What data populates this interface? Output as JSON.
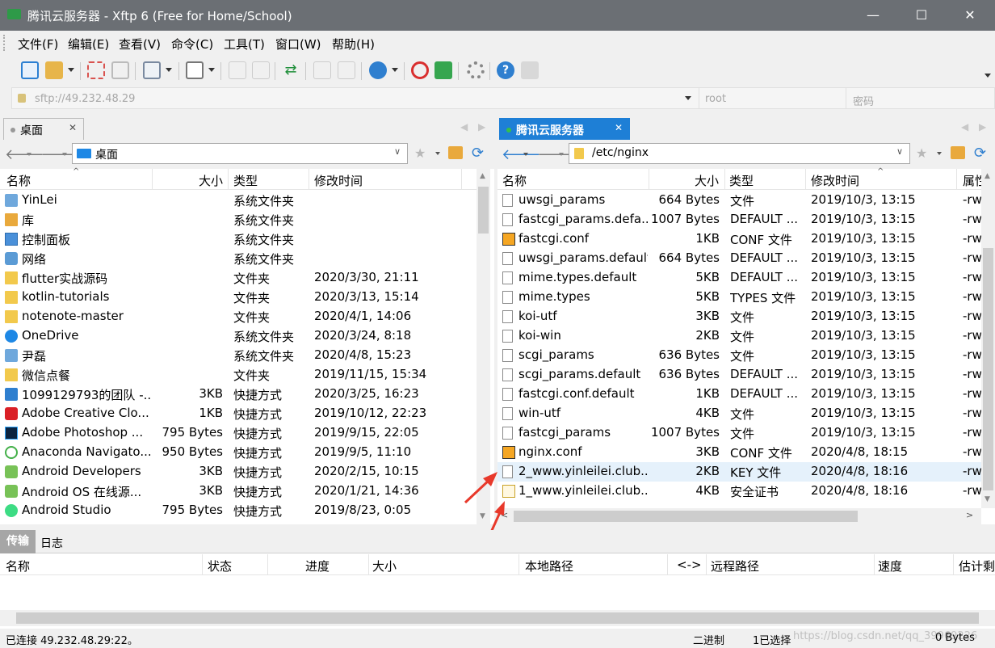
{
  "window": {
    "title": "腾讯云服务器 - Xftp 6 (Free for Home/School)",
    "minimize_glyph": "—",
    "maximize_glyph": "☐",
    "close_glyph": "✕"
  },
  "menu": [
    "文件(F)",
    "编辑(E)",
    "查看(V)",
    "命令(C)",
    "工具(T)",
    "窗口(W)",
    "帮助(H)"
  ],
  "address": {
    "host": "sftp://49.232.48.29",
    "user": "root",
    "password_placeholder": "密码"
  },
  "left": {
    "tab_label": "桌面",
    "path": "桌面",
    "columns": [
      "名称",
      "大小",
      "类型",
      "修改时间"
    ],
    "rows": [
      {
        "name": "YinLei",
        "size": "",
        "type": "系统文件夹",
        "date": "",
        "icon": "user-folder-icon"
      },
      {
        "name": "库",
        "size": "",
        "type": "系统文件夹",
        "date": "",
        "icon": "library-icon"
      },
      {
        "name": "控制面板",
        "size": "",
        "type": "系统文件夹",
        "date": "",
        "icon": "control-panel-icon"
      },
      {
        "name": "网络",
        "size": "",
        "type": "系统文件夹",
        "date": "",
        "icon": "network-icon"
      },
      {
        "name": "flutter实战源码",
        "size": "",
        "type": "文件夹",
        "date": "2020/3/30, 21:11",
        "icon": "folder-icon"
      },
      {
        "name": "kotlin-tutorials",
        "size": "",
        "type": "文件夹",
        "date": "2020/3/13, 15:14",
        "icon": "folder-icon"
      },
      {
        "name": "notenote-master",
        "size": "",
        "type": "文件夹",
        "date": "2020/4/1, 14:06",
        "icon": "folder-icon"
      },
      {
        "name": "OneDrive",
        "size": "",
        "type": "系统文件夹",
        "date": "2020/3/24, 8:18",
        "icon": "onedrive-icon"
      },
      {
        "name": "尹磊",
        "size": "",
        "type": "系统文件夹",
        "date": "2020/4/8, 15:23",
        "icon": "user-folder-icon"
      },
      {
        "name": "微信点餐",
        "size": "",
        "type": "文件夹",
        "date": "2019/11/15, 15:34",
        "icon": "folder-icon"
      },
      {
        "name": "1099129793的团队 -...",
        "size": "3KB",
        "type": "快捷方式",
        "date": "2020/3/25, 16:23",
        "icon": "shortcut-icon"
      },
      {
        "name": "Adobe Creative Clo...",
        "size": "1KB",
        "type": "快捷方式",
        "date": "2019/10/12, 22:23",
        "icon": "adobe-cc-icon"
      },
      {
        "name": "Adobe Photoshop ...",
        "size": "795 Bytes",
        "type": "快捷方式",
        "date": "2019/9/15, 22:05",
        "icon": "photoshop-icon"
      },
      {
        "name": "Anaconda Navigato...",
        "size": "950 Bytes",
        "type": "快捷方式",
        "date": "2019/9/5, 11:10",
        "icon": "anaconda-icon"
      },
      {
        "name": "Android Developers",
        "size": "3KB",
        "type": "快捷方式",
        "date": "2020/2/15, 10:15",
        "icon": "android-icon"
      },
      {
        "name": "Android OS 在线源...",
        "size": "3KB",
        "type": "快捷方式",
        "date": "2020/1/21, 14:36",
        "icon": "android-icon"
      },
      {
        "name": "Android Studio",
        "size": "795 Bytes",
        "type": "快捷方式",
        "date": "2019/8/23, 0:05",
        "icon": "android-studio-icon"
      }
    ]
  },
  "right": {
    "tab_label": "腾讯云服务器",
    "path": "/etc/nginx",
    "columns": [
      "名称",
      "大小",
      "类型",
      "修改时间",
      "属性"
    ],
    "rows": [
      {
        "name": "uwsgi_params",
        "size": "664 Bytes",
        "type": "文件",
        "date": "2019/10/3, 13:15",
        "attr": "-rw",
        "icon": "file-icon"
      },
      {
        "name": "fastcgi_params.defa...",
        "size": "1007 Bytes",
        "type": "DEFAULT ...",
        "date": "2019/10/3, 13:15",
        "attr": "-rw",
        "icon": "file-icon"
      },
      {
        "name": "fastcgi.conf",
        "size": "1KB",
        "type": "CONF 文件",
        "date": "2019/10/3, 13:15",
        "attr": "-rw",
        "icon": "sublime-file-icon"
      },
      {
        "name": "uwsgi_params.default",
        "size": "664 Bytes",
        "type": "DEFAULT ...",
        "date": "2019/10/3, 13:15",
        "attr": "-rw",
        "icon": "file-icon"
      },
      {
        "name": "mime.types.default",
        "size": "5KB",
        "type": "DEFAULT ...",
        "date": "2019/10/3, 13:15",
        "attr": "-rw",
        "icon": "file-icon"
      },
      {
        "name": "mime.types",
        "size": "5KB",
        "type": "TYPES 文件",
        "date": "2019/10/3, 13:15",
        "attr": "-rw",
        "icon": "file-icon"
      },
      {
        "name": "koi-utf",
        "size": "3KB",
        "type": "文件",
        "date": "2019/10/3, 13:15",
        "attr": "-rw",
        "icon": "file-icon"
      },
      {
        "name": "koi-win",
        "size": "2KB",
        "type": "文件",
        "date": "2019/10/3, 13:15",
        "attr": "-rw",
        "icon": "file-icon"
      },
      {
        "name": "scgi_params",
        "size": "636 Bytes",
        "type": "文件",
        "date": "2019/10/3, 13:15",
        "attr": "-rw",
        "icon": "file-icon"
      },
      {
        "name": "scgi_params.default",
        "size": "636 Bytes",
        "type": "DEFAULT ...",
        "date": "2019/10/3, 13:15",
        "attr": "-rw",
        "icon": "file-icon"
      },
      {
        "name": "fastcgi.conf.default",
        "size": "1KB",
        "type": "DEFAULT ...",
        "date": "2019/10/3, 13:15",
        "attr": "-rw",
        "icon": "file-icon"
      },
      {
        "name": "win-utf",
        "size": "4KB",
        "type": "文件",
        "date": "2019/10/3, 13:15",
        "attr": "-rw",
        "icon": "file-icon"
      },
      {
        "name": "fastcgi_params",
        "size": "1007 Bytes",
        "type": "文件",
        "date": "2019/10/3, 13:15",
        "attr": "-rw",
        "icon": "file-icon"
      },
      {
        "name": "nginx.conf",
        "size": "3KB",
        "type": "CONF 文件",
        "date": "2020/4/8, 18:15",
        "attr": "-rw",
        "icon": "sublime-file-icon"
      },
      {
        "name": "2_www.yinleilei.club...",
        "size": "2KB",
        "type": "KEY 文件",
        "date": "2020/4/8, 18:16",
        "attr": "-rw",
        "icon": "file-icon",
        "selected": true
      },
      {
        "name": "1_www.yinleilei.club...",
        "size": "4KB",
        "type": "安全证书",
        "date": "2020/4/8, 18:16",
        "attr": "-rw",
        "icon": "certificate-icon"
      }
    ]
  },
  "transfer": {
    "tabs": [
      "传输",
      "日志"
    ],
    "columns": [
      "名称",
      "状态",
      "进度",
      "大小",
      "本地路径",
      "<->",
      "远程路径",
      "速度",
      "估计剩"
    ]
  },
  "status": {
    "connected": "已连接 49.232.48.29:22。",
    "mode": "二进制",
    "selected": "1已选择",
    "bytes": "0 Bytes",
    "watermark": "https://blog.csdn.net/qq_39969226"
  },
  "colors": {
    "accent": "#1e7fd6",
    "titlebar": "#6b6f74",
    "arrow": "#e8392b",
    "selected_row": "#e5f1fb"
  }
}
